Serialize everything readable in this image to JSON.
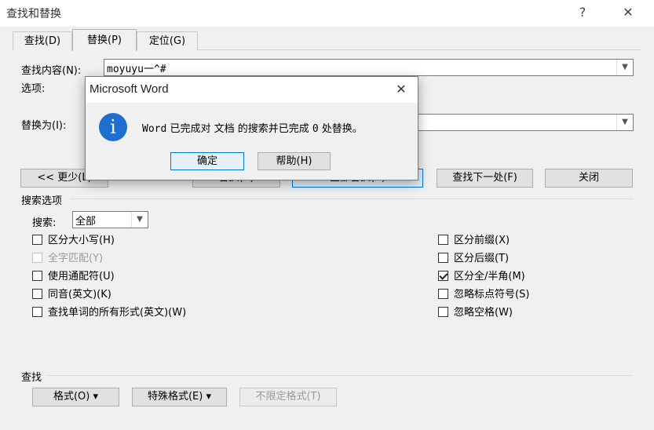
{
  "window": {
    "title": "查找和替换",
    "help_label": "?",
    "close_label": "✕"
  },
  "tabs": [
    {
      "label": "查找(D)"
    },
    {
      "label": "替换(P)"
    },
    {
      "label": "定位(G)"
    }
  ],
  "find": {
    "label": "查找内容(N):",
    "value": "moyuyu一^#"
  },
  "options": {
    "label": "选项:"
  },
  "replace": {
    "label": "替换为(I):",
    "value": ""
  },
  "buttons": {
    "less": "<< 更少(L)",
    "replace": "替换(R)",
    "replace_all": "全部替换(A)",
    "find_next": "查找下一处(F)",
    "close": "关闭"
  },
  "search_options": {
    "heading": "搜索选项",
    "search_label": "搜索:",
    "search_value": "全部",
    "left": [
      {
        "label": "区分大小写(H)",
        "checked": false,
        "disabled": false
      },
      {
        "label": "全字匹配(Y)",
        "checked": false,
        "disabled": true
      },
      {
        "label": "使用通配符(U)",
        "checked": false,
        "disabled": false
      },
      {
        "label": "同音(英文)(K)",
        "checked": false,
        "disabled": false
      },
      {
        "label": "查找单词的所有形式(英文)(W)",
        "checked": false,
        "disabled": false
      }
    ],
    "right": [
      {
        "label": "区分前缀(X)",
        "checked": false,
        "disabled": false
      },
      {
        "label": "区分后缀(T)",
        "checked": false,
        "disabled": false
      },
      {
        "label": "区分全/半角(M)",
        "checked": true,
        "disabled": false
      },
      {
        "label": "忽略标点符号(S)",
        "checked": false,
        "disabled": false
      },
      {
        "label": "忽略空格(W)",
        "checked": false,
        "disabled": false
      }
    ]
  },
  "bottom": {
    "heading": "查找",
    "format": "格式(O) ▾",
    "special": "特殊格式(E) ▾",
    "no_format": "不限定格式(T)"
  },
  "dialog": {
    "title": "Microsoft Word",
    "close_label": "✕",
    "icon": "info-icon",
    "message_a": "Word",
    "message_b": " 已完成对 文档 的搜索并已完成 ",
    "message_c": "0",
    "message_d": " 处替换。",
    "ok": "确定",
    "help": "帮助(H)"
  }
}
